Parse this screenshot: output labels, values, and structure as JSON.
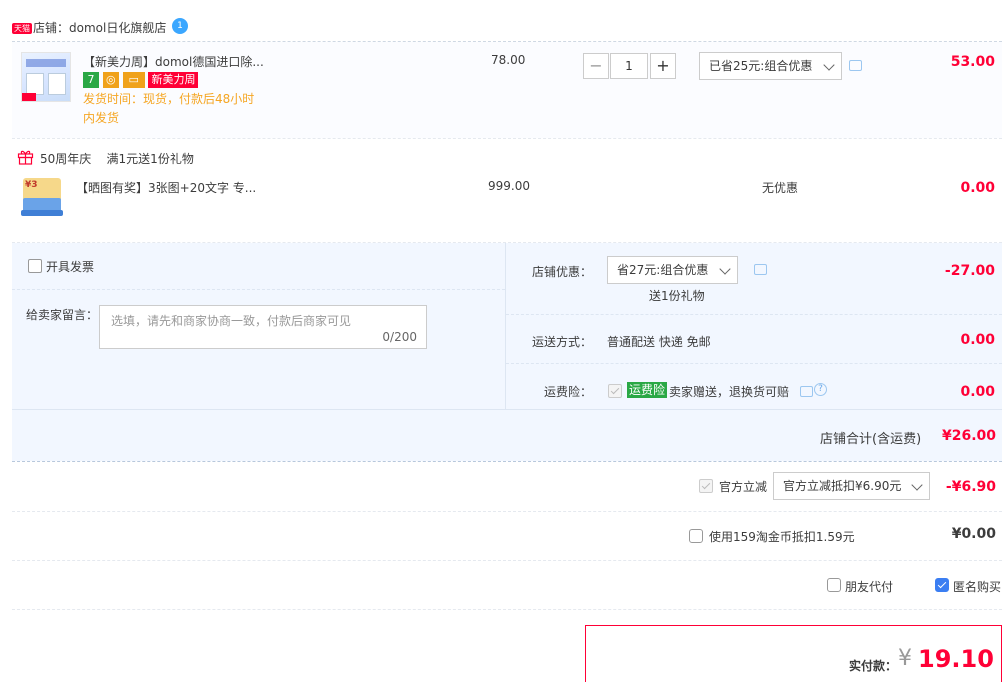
{
  "store": {
    "badge": "天猫",
    "prefix": "店铺：",
    "name": "domol日化旗舰店"
  },
  "item1": {
    "title": "【新美力周】domol德国进口除...",
    "promo_tag": "新美力周",
    "delivery": "发货时间：现货，付款后48小时",
    "delivery2": "内发货",
    "price": "78.00",
    "qty": "1",
    "discount_select": "已省25元:组合优惠",
    "subtotal": "53.00"
  },
  "gift": {
    "event": "50周年庆",
    "rule": "满1元送1份礼物",
    "title": "【晒图有奖】3张图+20文字 专...",
    "price": "999.00",
    "discount": "无优惠",
    "subtotal": "0.00"
  },
  "invoice": {
    "label": "开具发票"
  },
  "message": {
    "label": "给卖家留言：",
    "placeholder": "选填，请先和商家协商一致，付款后商家可见",
    "count": "0/200"
  },
  "store_discount": {
    "label": "店铺优惠：",
    "select": "省27元:组合优惠",
    "gift_note": "送1份礼物",
    "amount": "-27.00"
  },
  "shipping": {
    "label": "运送方式：",
    "value": "普通配送 快递 免邮",
    "amount": "0.00"
  },
  "insurance": {
    "label": "运费险：",
    "tag": "运费险",
    "desc": "卖家赠送，退换货可赔",
    "amount": "0.00"
  },
  "store_total": {
    "label": "店铺合计(含运费)",
    "amount": "¥26.00"
  },
  "official": {
    "label": "官方立减",
    "select": "官方立减抵扣¥6.90元",
    "amount": "-¥6.90"
  },
  "coins": {
    "label": "使用159淘金币抵扣1.59元",
    "amount": "¥0.00"
  },
  "options": {
    "friend_pay": "朋友代付",
    "anonymous": "匿名购买"
  },
  "payment": {
    "label": "实付款：",
    "currency": "¥",
    "amount": "19.10"
  },
  "colors": {
    "accent": "#ff0036",
    "panel": "#f2f7ff",
    "checkbox": "#3b7ef2"
  }
}
